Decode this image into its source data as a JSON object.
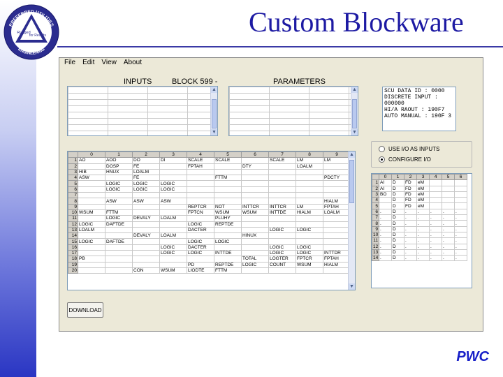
{
  "slide": {
    "title": "Custom Blockware",
    "footer": "PWC"
  },
  "logo": {
    "top_text": "PREFERRED UTILITIES",
    "middle_left": "Rugged",
    "middle_right": "for Results",
    "bottom_text": "ENGINEERING"
  },
  "colors": {
    "title": "#1d1aa3",
    "footer": "#1820c8",
    "sidebar_bottom": "#2a36c3",
    "window_bg": "#ece9d8"
  },
  "app": {
    "menu": [
      "File",
      "Edit",
      "View",
      "About"
    ],
    "inputs_label": "INPUTS",
    "block_label": "BLOCK 599 -",
    "parameters_label": "PARAMETERS",
    "param_list": [
      "SCU DATA ID  : 0000",
      "DISCRETE INPUT : 000000",
      "HI/A RAOUT : 190F7",
      "AUTO MANUAL : 190F 3"
    ],
    "options": [
      {
        "label": "USE I/O AS INPUTS",
        "selected": false
      },
      {
        "label": "CONFIGURE I/O",
        "selected": true
      }
    ],
    "download_label": "DOWNLOAD",
    "main_grid": {
      "col_headers": [
        "0",
        "1",
        "2",
        "3",
        "4",
        "5",
        "6",
        "7",
        "8",
        "9"
      ],
      "rows": [
        [
          "1",
          "AO",
          "AOO",
          "DO",
          "DI",
          "SCALE",
          "SCALE",
          "",
          "SCALE",
          "LM",
          "LM"
        ],
        [
          "2",
          "",
          "DOSP",
          "FE",
          "",
          "FPTAH",
          "",
          "DTY",
          "",
          "LOALM",
          ""
        ],
        [
          "3",
          "HIB",
          "HNUX",
          "LOALM",
          "",
          "",
          "",
          "",
          "",
          "",
          ""
        ],
        [
          "4",
          "ASW",
          "",
          "FE",
          "",
          "",
          "FTTM",
          "",
          "",
          "",
          "PDCTY"
        ],
        [
          "5",
          "",
          "LOGIC",
          "LOGIC",
          "LOGIC",
          "",
          "",
          "",
          "",
          "",
          ""
        ],
        [
          "6",
          "",
          "LOGIC",
          "LOGIC",
          "LOGIC",
          "",
          "",
          "",
          "",
          "",
          ""
        ],
        [
          "7",
          "",
          "",
          "",
          "",
          "",
          "",
          "",
          "",
          "",
          ""
        ],
        [
          "8",
          "",
          "ASW",
          "ASW",
          "ASW",
          "",
          "",
          "",
          "",
          "",
          "HIALM"
        ],
        [
          "9",
          "",
          "",
          "",
          "",
          "REPTCR",
          "NOT",
          "INTTCR",
          "INTTCR",
          "LM",
          "FPTAH"
        ],
        [
          "10",
          "WSUM",
          "FTTM",
          "",
          "",
          "FPTCN",
          "WSUM",
          "WSUM",
          "INTTDE",
          "HIALM",
          "LOALM"
        ],
        [
          "11",
          "",
          "LOGIC",
          "DEVALY",
          "LOALM",
          "",
          "PLUHY",
          "",
          "",
          "",
          ""
        ],
        [
          "12",
          "LOGIC",
          "DAFTDE",
          "",
          "",
          "LOGIC",
          "REPTDE",
          "",
          "",
          "",
          ""
        ],
        [
          "13",
          "LOALM",
          "",
          "",
          "",
          "DACTER",
          "",
          "",
          "LOGIC",
          "LOGIC",
          ""
        ],
        [
          "14",
          "",
          "",
          "DEVALY",
          "LOALM",
          "",
          "",
          "HINUX",
          "",
          "",
          ""
        ],
        [
          "15",
          "LOGIC",
          "DAFTDE",
          "",
          "",
          "LOGIC",
          "LOGIC",
          "",
          "",
          "",
          ""
        ],
        [
          "16",
          "",
          "",
          "",
          "LOGIC",
          "DACTER",
          "",
          "",
          "LOGIC",
          "LOGIC",
          ""
        ],
        [
          "17",
          "",
          "",
          "",
          "LOGIC",
          "LOGIC",
          "INTTDE",
          "",
          "LOGIC",
          "LOGIC",
          "INTTDR"
        ],
        [
          "18",
          "PB",
          "",
          "",
          "",
          "",
          "",
          "TOTAL",
          "LOGTER",
          "FPTCR",
          "FPTAH"
        ],
        [
          "19",
          "",
          "",
          "",
          "",
          "PD",
          "REPTDE",
          "LOGIC",
          "COUNT",
          "WSUM",
          "HIALM"
        ],
        [
          "20",
          "",
          "",
          "CON",
          "WSUM",
          "LIODTE",
          "FTTM",
          "",
          "",
          "",
          ""
        ]
      ]
    },
    "io_grid": {
      "col_headers": [
        "0",
        "1",
        "2",
        "3",
        "4",
        "5",
        "6"
      ],
      "rows": [
        [
          "1",
          "AI",
          "D",
          "FD",
          "eM",
          "",
          "",
          ""
        ],
        [
          "2",
          "AI",
          "D",
          "FD",
          "eM",
          "",
          "",
          ""
        ],
        [
          "3",
          "BO",
          "D",
          "FD",
          "eM",
          "",
          "",
          ""
        ],
        [
          "4",
          "",
          "D",
          "FD",
          "eM",
          "",
          "",
          ""
        ],
        [
          "5",
          "",
          "D",
          "FD",
          "eM",
          "",
          "",
          ""
        ],
        [
          "6",
          ".",
          "D",
          ".",
          ".",
          ".",
          ".",
          "."
        ],
        [
          "7",
          ".",
          "D",
          ".",
          ".",
          ".",
          ".",
          "."
        ],
        [
          "8",
          ".",
          "D",
          ".",
          ".",
          ".",
          ".",
          "."
        ],
        [
          "9",
          ".",
          "D",
          ".",
          ".",
          ".",
          ".",
          "."
        ],
        [
          "10",
          ".",
          "D",
          ".",
          ".",
          ".",
          ".",
          "."
        ],
        [
          "11",
          ".",
          "D",
          ".",
          ".",
          ".",
          ".",
          "."
        ],
        [
          "12",
          ".",
          "D",
          ".",
          ".",
          ".",
          ".",
          "."
        ],
        [
          "13",
          ".",
          "D",
          ".",
          ".",
          ".",
          ".",
          "."
        ],
        [
          "14",
          ".",
          "D",
          ".",
          ".",
          ".",
          ".",
          "."
        ]
      ]
    }
  }
}
